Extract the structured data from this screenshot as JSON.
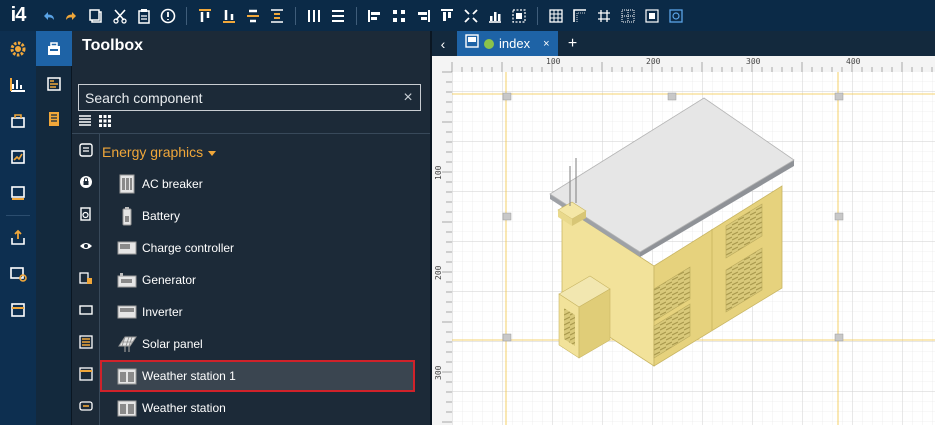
{
  "app": {
    "logo": "i4"
  },
  "toolbar": {
    "groups": [
      [
        "undo-icon",
        "redo-icon",
        "copy-icon",
        "cut-icon",
        "paste-icon",
        "info-icon"
      ],
      [
        "align-top-icon",
        "align-bottom-icon",
        "align-middle-icon",
        "distribute-icon"
      ],
      [
        "columns-icon",
        "rows-icon"
      ],
      [
        "align-left-icon",
        "align-center-icon",
        "align-right-icon",
        "align-top-edge-icon",
        "same-size-icon",
        "chart-icon",
        "group-icon"
      ],
      [
        "grid-icon",
        "snap-icon",
        "grid-lines-icon",
        "dotted-grid-icon",
        "center-grid-icon",
        "frame-icon"
      ]
    ]
  },
  "left_rail": [
    "settings-icon",
    "dashboard-icon",
    "power-icon",
    "report-icon",
    "list-icon",
    "export-icon",
    "monitor-icon",
    "window-icon"
  ],
  "second_rail": [
    "toolbox-icon",
    "layers-icon",
    "notes-icon"
  ],
  "toolbox": {
    "title": "Toolbox",
    "search_placeholder": "Search component",
    "clear_symbol": "×",
    "group_title": "Energy graphics",
    "components": [
      {
        "label": "AC breaker",
        "icon": "ac-breaker-icon"
      },
      {
        "label": "Battery",
        "icon": "battery-icon"
      },
      {
        "label": "Charge controller",
        "icon": "charge-controller-icon"
      },
      {
        "label": "Generator",
        "icon": "generator-icon"
      },
      {
        "label": "Inverter",
        "icon": "inverter-icon"
      },
      {
        "label": "Solar panel",
        "icon": "solar-panel-icon"
      },
      {
        "label": "Weather station 1",
        "icon": "weather-station-icon",
        "selected": true
      },
      {
        "label": "Weather station",
        "icon": "weather-station-icon"
      }
    ]
  },
  "editor": {
    "tab_label": "index",
    "tab_close": "×",
    "nav_prev": "‹",
    "add_tab": "+",
    "ruler_h": [
      "100",
      "200",
      "300",
      "400"
    ],
    "ruler_v": [
      "100",
      "200",
      "300"
    ]
  },
  "colors": {
    "accent": "#1e63a6",
    "selection": "#d0222a",
    "category": "#f0a73a",
    "building_wall": "#f3e39a",
    "building_roof": "#e4e4e4"
  }
}
